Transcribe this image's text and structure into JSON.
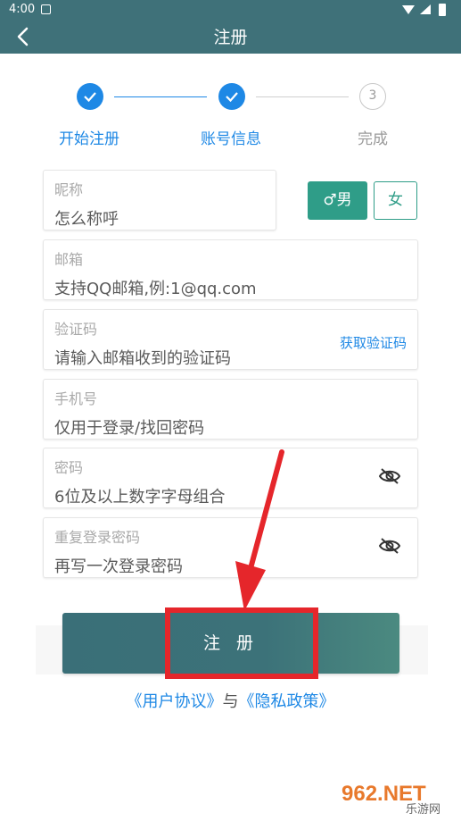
{
  "status_bar": {
    "time": "4:00"
  },
  "app_bar": {
    "title": "注册"
  },
  "stepper": {
    "steps": [
      {
        "label": "开始注册",
        "state": "done"
      },
      {
        "label": "账号信息",
        "state": "done"
      },
      {
        "label": "完成",
        "state": "pending",
        "number": "3"
      }
    ]
  },
  "form": {
    "nickname": {
      "label": "昵称",
      "hint": "怎么称呼"
    },
    "gender": {
      "male": "♂男",
      "female": "女"
    },
    "email": {
      "label": "邮箱",
      "hint": "支持QQ邮箱,例:1@qq.com"
    },
    "code": {
      "label": "验证码",
      "hint": "请输入邮箱收到的验证码",
      "action": "获取验证码"
    },
    "phone": {
      "label": "手机号",
      "hint": "仅用于登录/找回密码"
    },
    "password": {
      "label": "密码",
      "hint": "6位及以上数字字母组合"
    },
    "password_repeat": {
      "label": "重复登录密码",
      "hint": "再写一次登录密码"
    }
  },
  "register_button": {
    "label": "注 册"
  },
  "agreement": {
    "user_agreement": "《用户协议》",
    "joiner": "与",
    "privacy_policy": "《隐私政策》"
  },
  "watermark": {
    "text": "962.NET",
    "subtext": "乐游网"
  },
  "colors": {
    "header": "#3f7179",
    "accent_blue": "#1e88e5",
    "gender_green": "#2f9d88",
    "annotation_red": "#e5262b"
  }
}
